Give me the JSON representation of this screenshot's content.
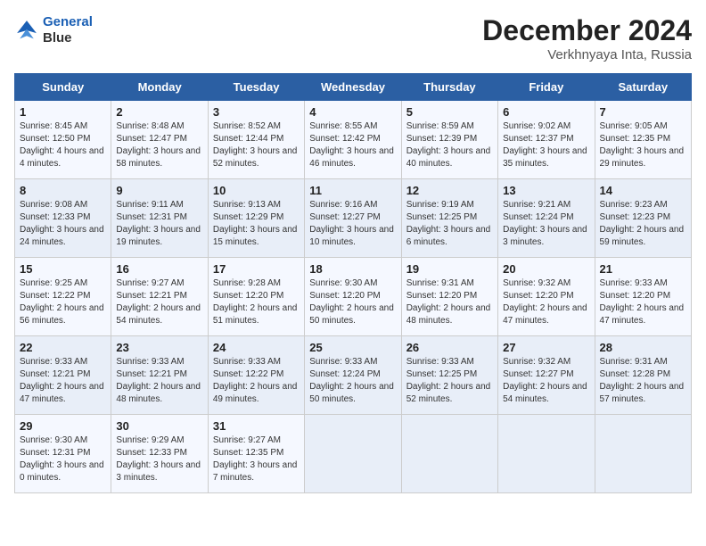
{
  "header": {
    "logo_line1": "General",
    "logo_line2": "Blue",
    "month": "December 2024",
    "location": "Verkhnyaya Inta, Russia"
  },
  "days_of_week": [
    "Sunday",
    "Monday",
    "Tuesday",
    "Wednesday",
    "Thursday",
    "Friday",
    "Saturday"
  ],
  "weeks": [
    [
      {
        "day": "1",
        "sunrise": "8:45 AM",
        "sunset": "12:50 PM",
        "daylight": "4 hours and 4 minutes."
      },
      {
        "day": "2",
        "sunrise": "8:48 AM",
        "sunset": "12:47 PM",
        "daylight": "3 hours and 58 minutes."
      },
      {
        "day": "3",
        "sunrise": "8:52 AM",
        "sunset": "12:44 PM",
        "daylight": "3 hours and 52 minutes."
      },
      {
        "day": "4",
        "sunrise": "8:55 AM",
        "sunset": "12:42 PM",
        "daylight": "3 hours and 46 minutes."
      },
      {
        "day": "5",
        "sunrise": "8:59 AM",
        "sunset": "12:39 PM",
        "daylight": "3 hours and 40 minutes."
      },
      {
        "day": "6",
        "sunrise": "9:02 AM",
        "sunset": "12:37 PM",
        "daylight": "3 hours and 35 minutes."
      },
      {
        "day": "7",
        "sunrise": "9:05 AM",
        "sunset": "12:35 PM",
        "daylight": "3 hours and 29 minutes."
      }
    ],
    [
      {
        "day": "8",
        "sunrise": "9:08 AM",
        "sunset": "12:33 PM",
        "daylight": "3 hours and 24 minutes."
      },
      {
        "day": "9",
        "sunrise": "9:11 AM",
        "sunset": "12:31 PM",
        "daylight": "3 hours and 19 minutes."
      },
      {
        "day": "10",
        "sunrise": "9:13 AM",
        "sunset": "12:29 PM",
        "daylight": "3 hours and 15 minutes."
      },
      {
        "day": "11",
        "sunrise": "9:16 AM",
        "sunset": "12:27 PM",
        "daylight": "3 hours and 10 minutes."
      },
      {
        "day": "12",
        "sunrise": "9:19 AM",
        "sunset": "12:25 PM",
        "daylight": "3 hours and 6 minutes."
      },
      {
        "day": "13",
        "sunrise": "9:21 AM",
        "sunset": "12:24 PM",
        "daylight": "3 hours and 3 minutes."
      },
      {
        "day": "14",
        "sunrise": "9:23 AM",
        "sunset": "12:23 PM",
        "daylight": "2 hours and 59 minutes."
      }
    ],
    [
      {
        "day": "15",
        "sunrise": "9:25 AM",
        "sunset": "12:22 PM",
        "daylight": "2 hours and 56 minutes."
      },
      {
        "day": "16",
        "sunrise": "9:27 AM",
        "sunset": "12:21 PM",
        "daylight": "2 hours and 54 minutes."
      },
      {
        "day": "17",
        "sunrise": "9:28 AM",
        "sunset": "12:20 PM",
        "daylight": "2 hours and 51 minutes."
      },
      {
        "day": "18",
        "sunrise": "9:30 AM",
        "sunset": "12:20 PM",
        "daylight": "2 hours and 50 minutes."
      },
      {
        "day": "19",
        "sunrise": "9:31 AM",
        "sunset": "12:20 PM",
        "daylight": "2 hours and 48 minutes."
      },
      {
        "day": "20",
        "sunrise": "9:32 AM",
        "sunset": "12:20 PM",
        "daylight": "2 hours and 47 minutes."
      },
      {
        "day": "21",
        "sunrise": "9:33 AM",
        "sunset": "12:20 PM",
        "daylight": "2 hours and 47 minutes."
      }
    ],
    [
      {
        "day": "22",
        "sunrise": "9:33 AM",
        "sunset": "12:21 PM",
        "daylight": "2 hours and 47 minutes."
      },
      {
        "day": "23",
        "sunrise": "9:33 AM",
        "sunset": "12:21 PM",
        "daylight": "2 hours and 48 minutes."
      },
      {
        "day": "24",
        "sunrise": "9:33 AM",
        "sunset": "12:22 PM",
        "daylight": "2 hours and 49 minutes."
      },
      {
        "day": "25",
        "sunrise": "9:33 AM",
        "sunset": "12:24 PM",
        "daylight": "2 hours and 50 minutes."
      },
      {
        "day": "26",
        "sunrise": "9:33 AM",
        "sunset": "12:25 PM",
        "daylight": "2 hours and 52 minutes."
      },
      {
        "day": "27",
        "sunrise": "9:32 AM",
        "sunset": "12:27 PM",
        "daylight": "2 hours and 54 minutes."
      },
      {
        "day": "28",
        "sunrise": "9:31 AM",
        "sunset": "12:28 PM",
        "daylight": "2 hours and 57 minutes."
      }
    ],
    [
      {
        "day": "29",
        "sunrise": "9:30 AM",
        "sunset": "12:31 PM",
        "daylight": "3 hours and 0 minutes."
      },
      {
        "day": "30",
        "sunrise": "9:29 AM",
        "sunset": "12:33 PM",
        "daylight": "3 hours and 3 minutes."
      },
      {
        "day": "31",
        "sunrise": "9:27 AM",
        "sunset": "12:35 PM",
        "daylight": "3 hours and 7 minutes."
      },
      null,
      null,
      null,
      null
    ]
  ]
}
